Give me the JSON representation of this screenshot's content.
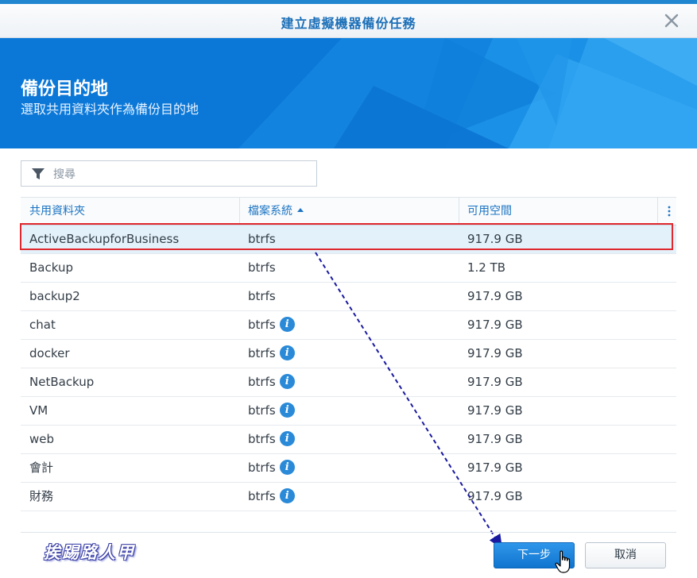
{
  "window": {
    "title": "建立虛擬機器備份任務",
    "close_icon": "close-icon"
  },
  "banner": {
    "title": "備份目的地",
    "subtitle": "選取共用資料夾作為備份目的地"
  },
  "search": {
    "placeholder": "搜尋",
    "value": "",
    "icon": "filter-icon"
  },
  "table": {
    "columns": [
      "共用資料夾",
      "檔案系統",
      "可用空間"
    ],
    "sorted_column": 1,
    "sort_direction": "ascending",
    "rows": [
      {
        "name": "ActiveBackupforBusiness",
        "fs": "btrfs",
        "info": false,
        "space": "917.9 GB",
        "selected": true
      },
      {
        "name": "Backup",
        "fs": "btrfs",
        "info": false,
        "space": "1.2 TB",
        "selected": false
      },
      {
        "name": "backup2",
        "fs": "btrfs",
        "info": false,
        "space": "917.9 GB",
        "selected": false
      },
      {
        "name": "chat",
        "fs": "btrfs",
        "info": true,
        "space": "917.9 GB",
        "selected": false
      },
      {
        "name": "docker",
        "fs": "btrfs",
        "info": true,
        "space": "917.9 GB",
        "selected": false
      },
      {
        "name": "NetBackup",
        "fs": "btrfs",
        "info": true,
        "space": "917.9 GB",
        "selected": false
      },
      {
        "name": "VM",
        "fs": "btrfs",
        "info": true,
        "space": "917.9 GB",
        "selected": false
      },
      {
        "name": "web",
        "fs": "btrfs",
        "info": true,
        "space": "917.9 GB",
        "selected": false
      },
      {
        "name": "會計",
        "fs": "btrfs",
        "info": true,
        "space": "917.9 GB",
        "selected": false
      },
      {
        "name": "財務",
        "fs": "btrfs",
        "info": true,
        "space": "917.9 GB",
        "selected": false
      }
    ]
  },
  "footer": {
    "next_label": "下一步",
    "cancel_label": "取消",
    "watermark": "挨踢路人甲"
  },
  "colors": {
    "accent": "#1b74c4",
    "banner": "#0a6fd0",
    "highlight": "#e0282e",
    "annotation_arrow": "#1a1aa0",
    "info": "#2a8ad8"
  }
}
